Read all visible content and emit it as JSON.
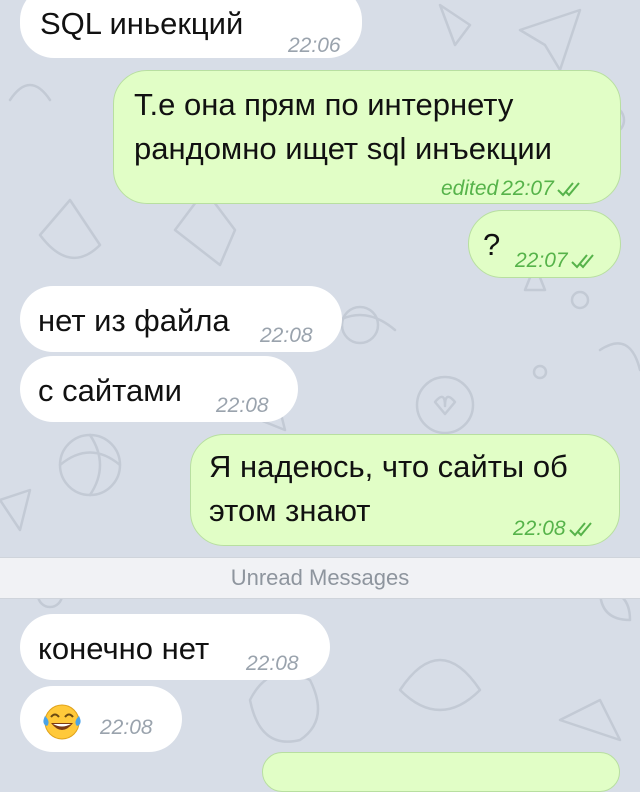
{
  "messages": [
    {
      "text": "SQL иньекций",
      "time": "22:06"
    },
    {
      "line1": "Т.е она прям по интернету",
      "line2": "рандомно ищет sql инъекции",
      "status": "edited",
      "time": "22:07"
    },
    {
      "text": "?",
      "time": "22:07"
    },
    {
      "text": "нет из файла",
      "time": "22:08"
    },
    {
      "text": "с сайтами",
      "time": "22:08"
    },
    {
      "line1": "Я надеюсь, что сайты об",
      "line2": "этом знают",
      "time": "22:08"
    },
    {
      "text": "конечно нет",
      "time": "22:08"
    },
    {
      "emoji": "laughing-tears-emoji",
      "time": "22:08"
    }
  ],
  "divider": {
    "label": "Unread Messages"
  },
  "colors": {
    "outgoing_bubble": "#e1fec6",
    "incoming_bubble": "#ffffff",
    "checkmark": "#56b34a",
    "background": "#d7dde7"
  }
}
